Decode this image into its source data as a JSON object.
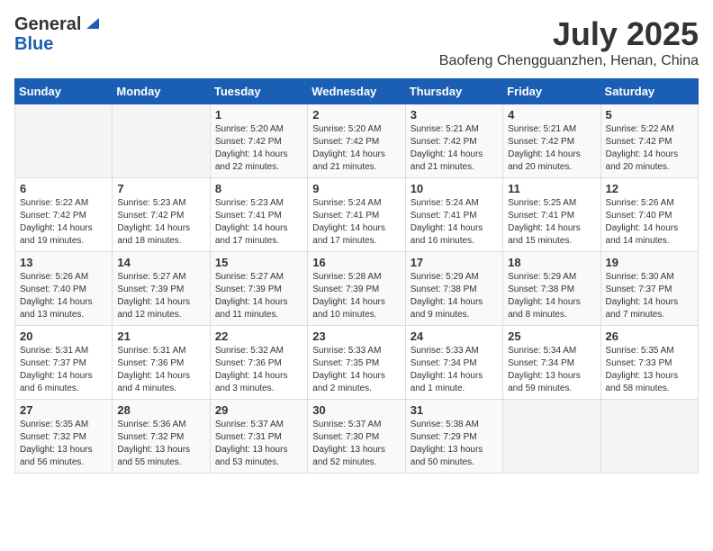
{
  "header": {
    "logo_general": "General",
    "logo_blue": "Blue",
    "month": "July 2025",
    "location": "Baofeng Chengguanzhen, Henan, China"
  },
  "weekdays": [
    "Sunday",
    "Monday",
    "Tuesday",
    "Wednesday",
    "Thursday",
    "Friday",
    "Saturday"
  ],
  "weeks": [
    [
      {
        "day": "",
        "info": ""
      },
      {
        "day": "",
        "info": ""
      },
      {
        "day": "1",
        "info": "Sunrise: 5:20 AM\nSunset: 7:42 PM\nDaylight: 14 hours and 22 minutes."
      },
      {
        "day": "2",
        "info": "Sunrise: 5:20 AM\nSunset: 7:42 PM\nDaylight: 14 hours and 21 minutes."
      },
      {
        "day": "3",
        "info": "Sunrise: 5:21 AM\nSunset: 7:42 PM\nDaylight: 14 hours and 21 minutes."
      },
      {
        "day": "4",
        "info": "Sunrise: 5:21 AM\nSunset: 7:42 PM\nDaylight: 14 hours and 20 minutes."
      },
      {
        "day": "5",
        "info": "Sunrise: 5:22 AM\nSunset: 7:42 PM\nDaylight: 14 hours and 20 minutes."
      }
    ],
    [
      {
        "day": "6",
        "info": "Sunrise: 5:22 AM\nSunset: 7:42 PM\nDaylight: 14 hours and 19 minutes."
      },
      {
        "day": "7",
        "info": "Sunrise: 5:23 AM\nSunset: 7:42 PM\nDaylight: 14 hours and 18 minutes."
      },
      {
        "day": "8",
        "info": "Sunrise: 5:23 AM\nSunset: 7:41 PM\nDaylight: 14 hours and 17 minutes."
      },
      {
        "day": "9",
        "info": "Sunrise: 5:24 AM\nSunset: 7:41 PM\nDaylight: 14 hours and 17 minutes."
      },
      {
        "day": "10",
        "info": "Sunrise: 5:24 AM\nSunset: 7:41 PM\nDaylight: 14 hours and 16 minutes."
      },
      {
        "day": "11",
        "info": "Sunrise: 5:25 AM\nSunset: 7:41 PM\nDaylight: 14 hours and 15 minutes."
      },
      {
        "day": "12",
        "info": "Sunrise: 5:26 AM\nSunset: 7:40 PM\nDaylight: 14 hours and 14 minutes."
      }
    ],
    [
      {
        "day": "13",
        "info": "Sunrise: 5:26 AM\nSunset: 7:40 PM\nDaylight: 14 hours and 13 minutes."
      },
      {
        "day": "14",
        "info": "Sunrise: 5:27 AM\nSunset: 7:39 PM\nDaylight: 14 hours and 12 minutes."
      },
      {
        "day": "15",
        "info": "Sunrise: 5:27 AM\nSunset: 7:39 PM\nDaylight: 14 hours and 11 minutes."
      },
      {
        "day": "16",
        "info": "Sunrise: 5:28 AM\nSunset: 7:39 PM\nDaylight: 14 hours and 10 minutes."
      },
      {
        "day": "17",
        "info": "Sunrise: 5:29 AM\nSunset: 7:38 PM\nDaylight: 14 hours and 9 minutes."
      },
      {
        "day": "18",
        "info": "Sunrise: 5:29 AM\nSunset: 7:38 PM\nDaylight: 14 hours and 8 minutes."
      },
      {
        "day": "19",
        "info": "Sunrise: 5:30 AM\nSunset: 7:37 PM\nDaylight: 14 hours and 7 minutes."
      }
    ],
    [
      {
        "day": "20",
        "info": "Sunrise: 5:31 AM\nSunset: 7:37 PM\nDaylight: 14 hours and 6 minutes."
      },
      {
        "day": "21",
        "info": "Sunrise: 5:31 AM\nSunset: 7:36 PM\nDaylight: 14 hours and 4 minutes."
      },
      {
        "day": "22",
        "info": "Sunrise: 5:32 AM\nSunset: 7:36 PM\nDaylight: 14 hours and 3 minutes."
      },
      {
        "day": "23",
        "info": "Sunrise: 5:33 AM\nSunset: 7:35 PM\nDaylight: 14 hours and 2 minutes."
      },
      {
        "day": "24",
        "info": "Sunrise: 5:33 AM\nSunset: 7:34 PM\nDaylight: 14 hours and 1 minute."
      },
      {
        "day": "25",
        "info": "Sunrise: 5:34 AM\nSunset: 7:34 PM\nDaylight: 13 hours and 59 minutes."
      },
      {
        "day": "26",
        "info": "Sunrise: 5:35 AM\nSunset: 7:33 PM\nDaylight: 13 hours and 58 minutes."
      }
    ],
    [
      {
        "day": "27",
        "info": "Sunrise: 5:35 AM\nSunset: 7:32 PM\nDaylight: 13 hours and 56 minutes."
      },
      {
        "day": "28",
        "info": "Sunrise: 5:36 AM\nSunset: 7:32 PM\nDaylight: 13 hours and 55 minutes."
      },
      {
        "day": "29",
        "info": "Sunrise: 5:37 AM\nSunset: 7:31 PM\nDaylight: 13 hours and 53 minutes."
      },
      {
        "day": "30",
        "info": "Sunrise: 5:37 AM\nSunset: 7:30 PM\nDaylight: 13 hours and 52 minutes."
      },
      {
        "day": "31",
        "info": "Sunrise: 5:38 AM\nSunset: 7:29 PM\nDaylight: 13 hours and 50 minutes."
      },
      {
        "day": "",
        "info": ""
      },
      {
        "day": "",
        "info": ""
      }
    ]
  ]
}
